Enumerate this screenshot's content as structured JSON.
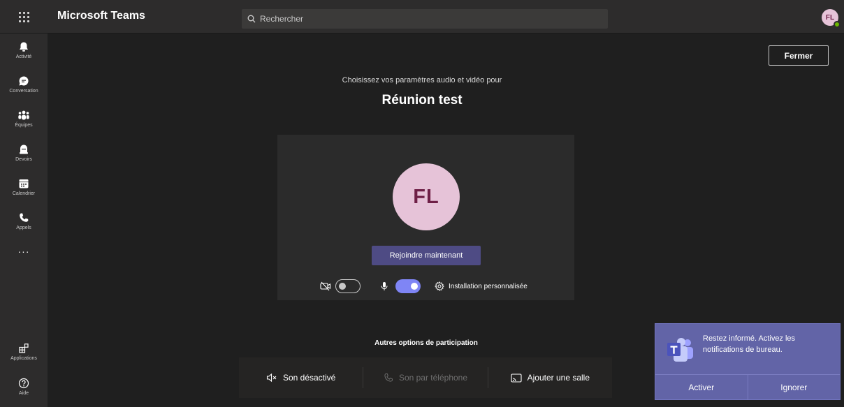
{
  "app": {
    "title": "Microsoft Teams"
  },
  "search": {
    "placeholder": "Rechercher"
  },
  "user": {
    "initials": "FL"
  },
  "rail": {
    "items": [
      {
        "label": "Activité",
        "icon": "bell-icon"
      },
      {
        "label": "Conversation",
        "icon": "chat-icon"
      },
      {
        "label": "Équipes",
        "icon": "teams-icon"
      },
      {
        "label": "Devoirs",
        "icon": "assignments-icon"
      },
      {
        "label": "Calendrier",
        "icon": "calendar-icon"
      },
      {
        "label": "Appels",
        "icon": "phone-icon"
      }
    ],
    "more": "···",
    "bottom": [
      {
        "label": "Applications",
        "icon": "apps-icon"
      },
      {
        "label": "Aide",
        "icon": "help-icon"
      }
    ]
  },
  "main": {
    "close_label": "Fermer",
    "subtitle": "Choisissez vos paramètres audio et vidéo pour",
    "meeting_title": "Réunion test",
    "join_label": "Rejoindre maintenant",
    "controls": {
      "camera_on": false,
      "mic_on": true,
      "custom_setup_label": "Installation personnalisée"
    },
    "other_options_title": "Autres options de participation",
    "options": [
      {
        "label": "Son désactivé",
        "icon": "speaker-off-icon",
        "enabled": true
      },
      {
        "label": "Son par téléphone",
        "icon": "phone-icon",
        "enabled": false
      },
      {
        "label": "Ajouter une salle",
        "icon": "cast-icon",
        "enabled": true
      }
    ]
  },
  "toast": {
    "message": "Restez informé. Activez les notifications de bureau.",
    "activate_label": "Activer",
    "ignore_label": "Ignorer"
  },
  "colors": {
    "accent": "#6264a7",
    "join_button": "#4e4b84",
    "avatar_bg": "#e6c3d8",
    "avatar_text": "#6e1f46",
    "toggle_on": "#7f85f5",
    "presence": "#6bb700"
  }
}
